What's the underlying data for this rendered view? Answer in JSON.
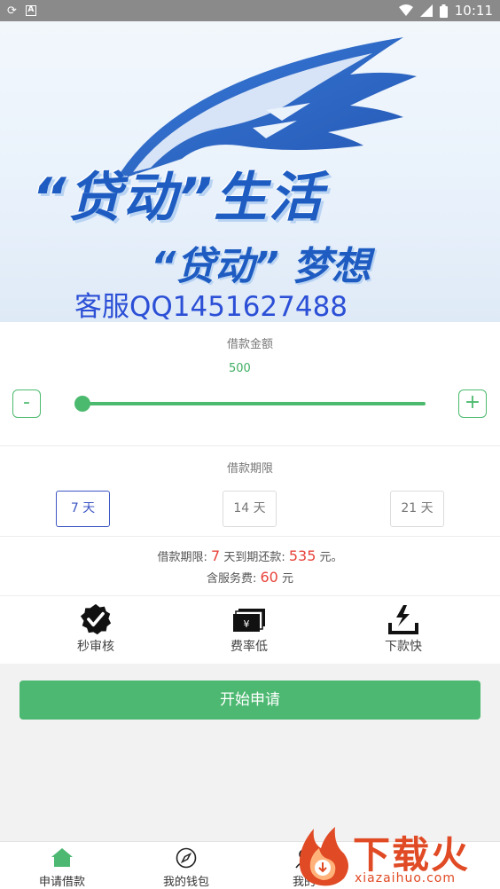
{
  "status_bar": {
    "time": "10:11",
    "icons": [
      "sync-icon",
      "a-icon",
      "wifi-icon",
      "signal-icon",
      "battery-icon"
    ]
  },
  "banner": {
    "headline": "“贷动”生活",
    "subline": "“贷动” 梦想",
    "qq": "客服QQ1451627488"
  },
  "amount": {
    "label": "借款金额",
    "value": "500",
    "minus_label": "-",
    "plus_label": "+",
    "slider_fraction": 0.0
  },
  "term": {
    "label": "借款期限",
    "options": [
      "7 天",
      "14 天",
      "21 天"
    ],
    "selected_index": 0
  },
  "summary": {
    "line1_prefix": "借款期限:",
    "days": "7",
    "line1_mid": "天到期还款:",
    "repay": "535",
    "line1_suffix": "元。",
    "line2_prefix": "含服务费:",
    "fee": "60",
    "line2_suffix": "元"
  },
  "features": [
    {
      "label": "秒审核",
      "icon": "verified-badge-icon"
    },
    {
      "label": "费率低",
      "icon": "money-stack-icon"
    },
    {
      "label": "下款快",
      "icon": "lightning-download-icon"
    }
  ],
  "apply_button": "开始申请",
  "bottom_nav": [
    {
      "label": "申请借款",
      "icon": "home-icon"
    },
    {
      "label": "我的钱包",
      "icon": "compass-icon"
    },
    {
      "label": "我的",
      "icon": "user-icon"
    }
  ],
  "watermark": {
    "text": "下载火",
    "domain": "xiazaihuo.com"
  },
  "colors": {
    "accent_green": "#4cb871",
    "accent_blue": "#3d56c4",
    "highlight_red": "#e8433a",
    "banner_blue": "#1e5cc2",
    "watermark_orange": "#e04a24"
  }
}
